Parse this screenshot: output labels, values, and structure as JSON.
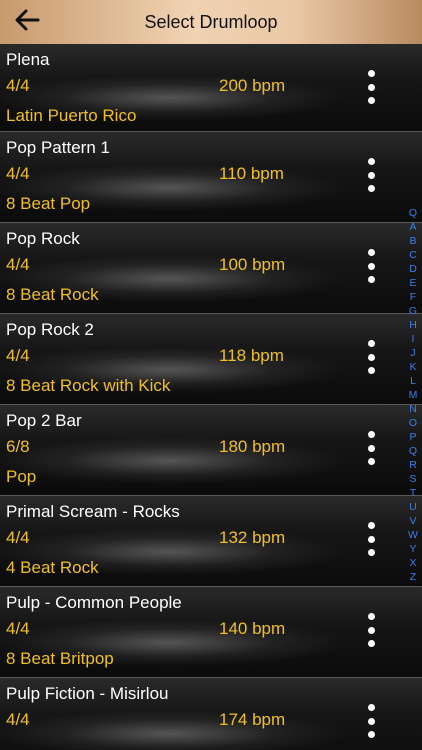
{
  "header": {
    "title": "Select Drumloop",
    "back_icon": "arrow-left-icon"
  },
  "items": [
    {
      "name": "Plena",
      "meter": "4/4",
      "bpm": "200 bpm",
      "style": "Latin Puerto Rico"
    },
    {
      "name": "Pop Pattern 1",
      "meter": "4/4",
      "bpm": "110 bpm",
      "style": "8 Beat Pop"
    },
    {
      "name": "Pop Rock",
      "meter": "4/4",
      "bpm": "100 bpm",
      "style": "8 Beat Rock"
    },
    {
      "name": "Pop Rock 2",
      "meter": "4/4",
      "bpm": "118 bpm",
      "style": "8 Beat Rock with Kick"
    },
    {
      "name": "Pop 2 Bar",
      "meter": "6/8",
      "bpm": "180 bpm",
      "style": "Pop"
    },
    {
      "name": "Primal Scream - Rocks",
      "meter": "4/4",
      "bpm": "132 bpm",
      "style": "4 Beat Rock"
    },
    {
      "name": "Pulp - Common People",
      "meter": "4/4",
      "bpm": "140 bpm",
      "style": "8 Beat Britpop"
    },
    {
      "name": "Pulp Fiction - Misirlou",
      "meter": "4/4",
      "bpm": "174 bpm",
      "style": ""
    }
  ],
  "index": [
    "Q",
    "A",
    "B",
    "C",
    "D",
    "E",
    "F",
    "G",
    "H",
    "I",
    "J",
    "K",
    "L",
    "M",
    "N",
    "O",
    "P",
    "Q",
    "R",
    "S",
    "T",
    "U",
    "V",
    "W",
    "Y",
    "X",
    "Z"
  ],
  "colors": {
    "accent_yellow": "#f0c020",
    "index_blue": "#3a7ff0",
    "header_gold": "#e9c8a6"
  }
}
